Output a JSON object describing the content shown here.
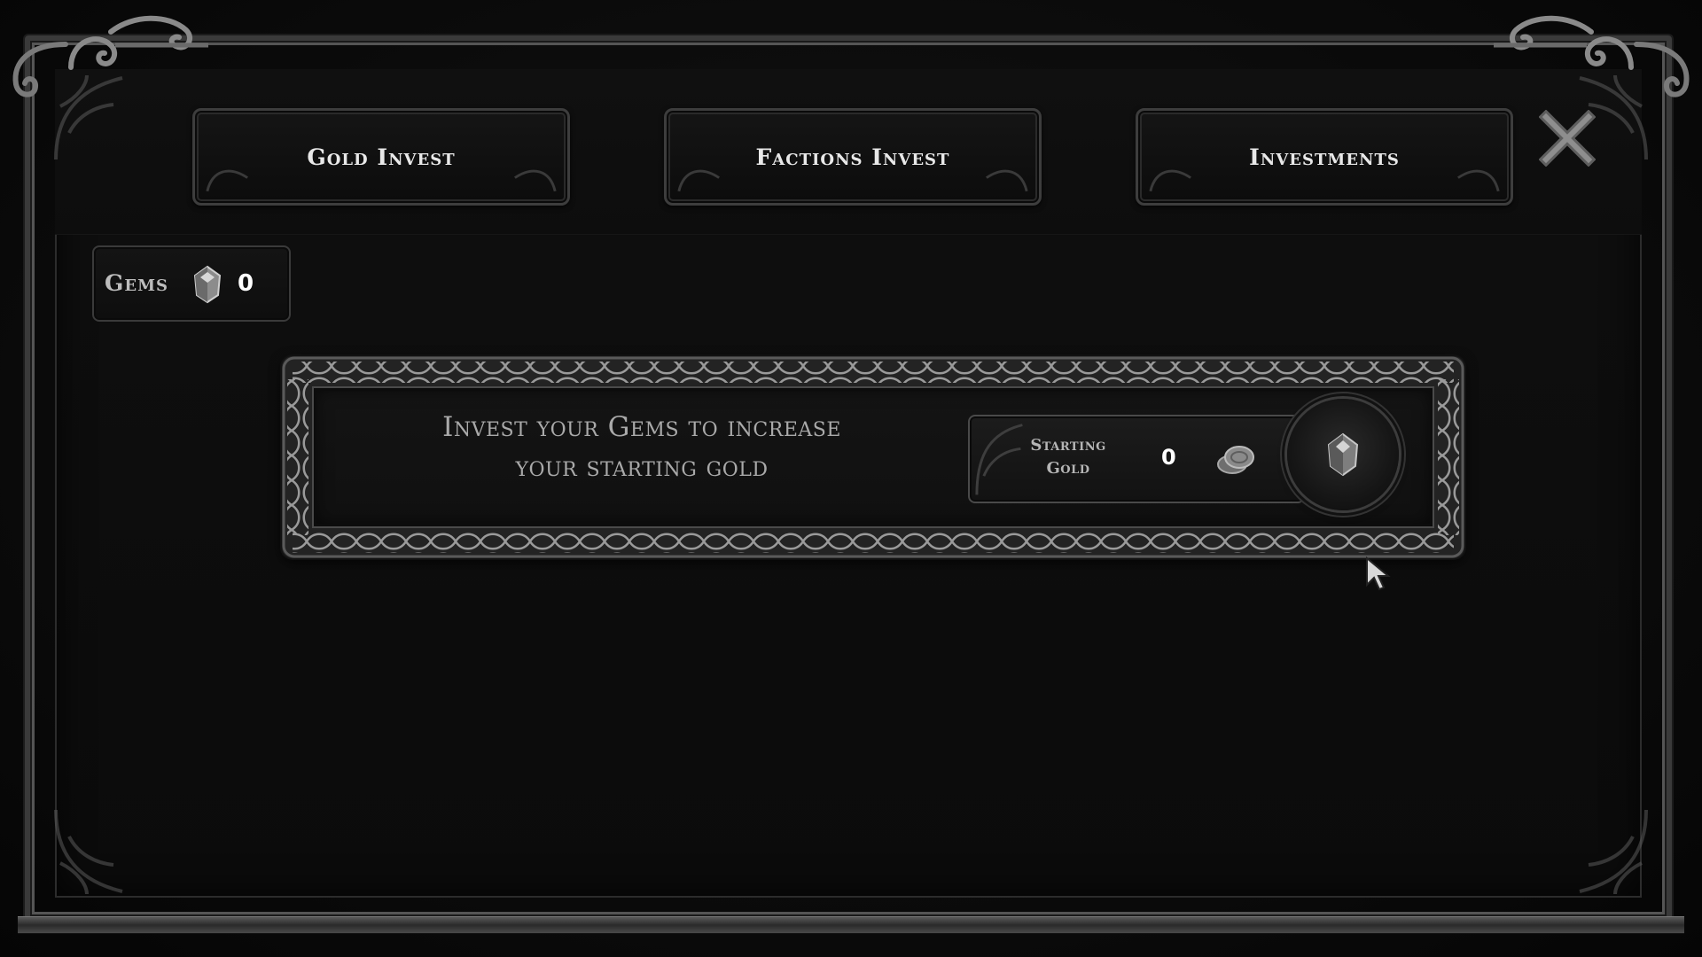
{
  "tabs": [
    {
      "label": "Gold Invest"
    },
    {
      "label": "Factions Invest"
    },
    {
      "label": "Investments"
    }
  ],
  "gems": {
    "label": "Gems",
    "count": "0",
    "icon": "gem-icon"
  },
  "invest_panel": {
    "description": "Invest your Gems to increase your starting gold",
    "starting_gold": {
      "label": "Starting Gold",
      "value": "0",
      "icon": "coin-stack-icon"
    },
    "invest_button_icon": "gem-icon"
  },
  "close_icon": "close-icon",
  "colors": {
    "background": "#0b0b0b",
    "frame": "#3a3a3a",
    "text_primary": "#e8e8e8",
    "text_secondary": "#a9a9a9"
  }
}
